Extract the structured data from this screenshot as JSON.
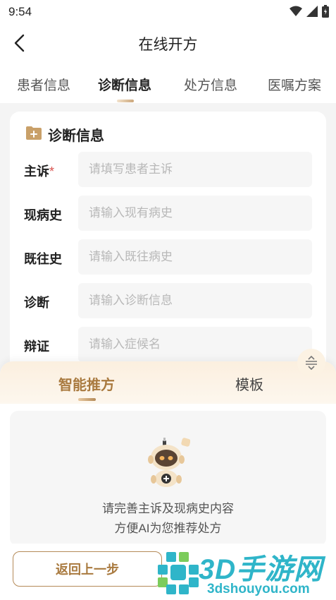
{
  "status_bar": {
    "time": "9:54"
  },
  "nav": {
    "title": "在线开方"
  },
  "tabs": [
    {
      "label": "患者信息"
    },
    {
      "label": "诊断信息"
    },
    {
      "label": "处方信息"
    },
    {
      "label": "医嘱方案"
    }
  ],
  "diagnosis_card": {
    "title": "诊断信息",
    "fields": [
      {
        "label": "主诉",
        "required_mark": "*",
        "placeholder": "请填写患者主诉",
        "value": ""
      },
      {
        "label": "现病史",
        "placeholder": "请输入现有病史",
        "value": ""
      },
      {
        "label": "既往史",
        "placeholder": "请输入既往病史",
        "value": ""
      },
      {
        "label": "诊断",
        "placeholder": "请输入诊断信息",
        "value": ""
      },
      {
        "label": "辩证",
        "placeholder": "请输入症候名",
        "value": ""
      }
    ]
  },
  "panel": {
    "tabs": [
      {
        "label": "智能推方"
      },
      {
        "label": "模板"
      }
    ],
    "empty_line1": "请完善主诉及现病史内容",
    "empty_line2": "方便AI为您推荐处方"
  },
  "bottom": {
    "back_label": "返回上一步"
  },
  "watermark": {
    "brand": "3D手游网",
    "domain": "3dshouyou.com"
  },
  "colors": {
    "accent": "#a97a3f",
    "accent_light": "#fbefdf",
    "required": "#d9534f",
    "watermark": "#2fb5c9"
  },
  "icons": [
    "wifi-icon",
    "signal-icon",
    "battery-icon",
    "back-arrow-icon",
    "folder-plus-icon",
    "collapse-icon",
    "robot-icon"
  ]
}
